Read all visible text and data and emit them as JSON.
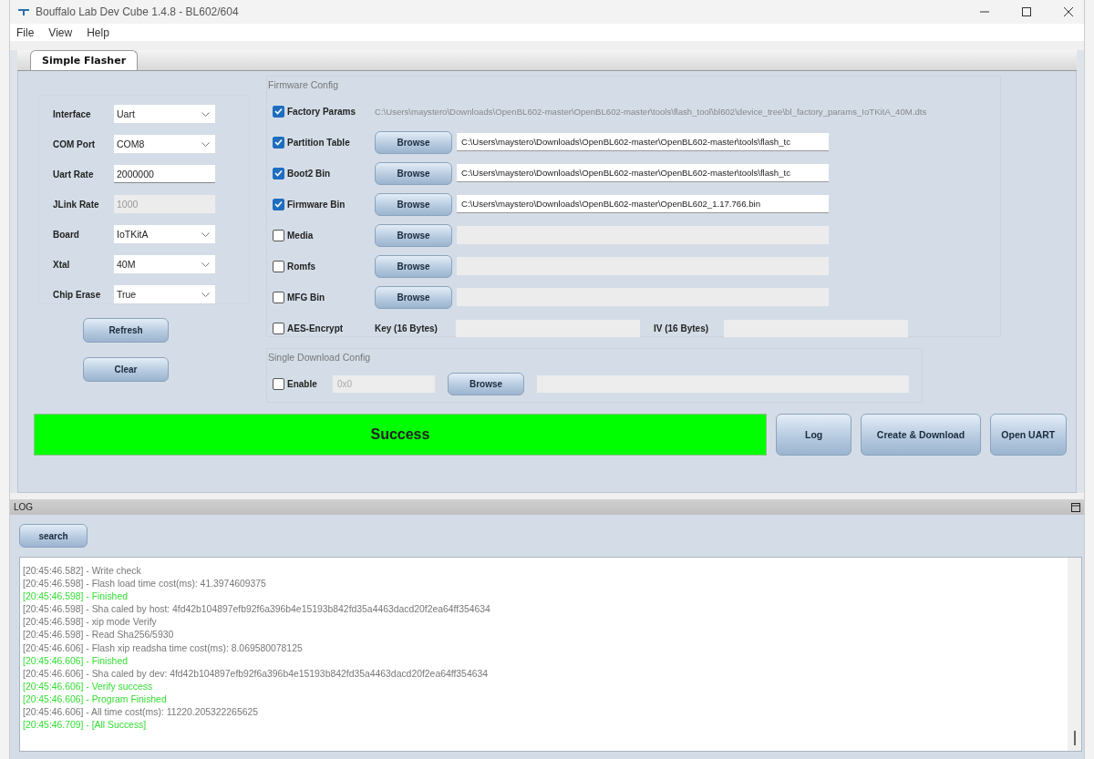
{
  "window": {
    "title": "Bouffalo Lab Dev Cube 1.4.8 - BL602/604"
  },
  "menu": [
    "File",
    "View",
    "Help"
  ],
  "tabs": [
    {
      "label": "Simple Flasher",
      "selected": true
    }
  ],
  "interface_config": {
    "fields": [
      {
        "label": "Interface",
        "kind": "select",
        "value": "Uart",
        "disabled": false
      },
      {
        "label": "COM Port",
        "kind": "select",
        "value": "COM8",
        "disabled": false
      },
      {
        "label": "Uart Rate",
        "kind": "input",
        "value": "2000000",
        "disabled": false
      },
      {
        "label": "JLink Rate",
        "kind": "input",
        "value": "1000",
        "disabled": true
      },
      {
        "label": "Board",
        "kind": "select",
        "value": "IoTKitA",
        "disabled": false
      },
      {
        "label": "Xtal",
        "kind": "select",
        "value": "40M",
        "disabled": false
      },
      {
        "label": "Chip Erase",
        "kind": "select",
        "value": "True",
        "disabled": false
      }
    ],
    "buttons": [
      "Refresh",
      "Clear"
    ]
  },
  "firmware_config": {
    "title": "Firmware Config",
    "rows": [
      {
        "kind": "text",
        "label": "Factory Params",
        "checked": true,
        "value": "C:\\Users\\maystero\\Downloads\\OpenBL602-master\\OpenBL602-master\\tools\\flash_tool\\bl602\\device_tree\\bl_factory_params_IoTKitA_40M.dts"
      },
      {
        "kind": "file",
        "label": "Partition Table",
        "checked": true,
        "button": "Browse",
        "value": "C:\\Users\\maystero\\Downloads\\OpenBL602-master\\OpenBL602-master\\tools\\flash_tc"
      },
      {
        "kind": "file",
        "label": "Boot2 Bin",
        "checked": true,
        "button": "Browse",
        "value": "C:\\Users\\maystero\\Downloads\\OpenBL602-master\\OpenBL602-master\\tools\\flash_tc"
      },
      {
        "kind": "file",
        "label": "Firmware Bin",
        "checked": true,
        "button": "Browse",
        "value": "C:\\Users\\maystero\\Downloads\\OpenBL602-master\\OpenBL602_1.17.766.bin"
      },
      {
        "kind": "file",
        "label": "Media",
        "checked": false,
        "button": "Browse"
      },
      {
        "kind": "file",
        "label": "Romfs",
        "checked": false,
        "button": "Browse"
      },
      {
        "kind": "file",
        "label": "MFG Bin",
        "checked": false,
        "button": "Browse"
      },
      {
        "kind": "aes",
        "label": "AES-Encrypt",
        "checked": false,
        "key_label": "Key (16 Bytes)",
        "iv_label": "IV (16 Bytes)"
      }
    ]
  },
  "single_download": {
    "title": "Single Download Config",
    "label": "Enable",
    "checked": false,
    "address": "0x0",
    "button": "Browse"
  },
  "status": {
    "kind": "success",
    "text": "Success"
  },
  "actions": [
    "Log",
    "Create & Download",
    "Open UART"
  ],
  "log": {
    "title": "LOG",
    "search_button": "search",
    "lines": [
      {
        "kind": "info",
        "text": "[20:45:46.582] - Write check"
      },
      {
        "kind": "info",
        "text": "[20:45:46.598] - Flash load time cost(ms): 41.3974609375"
      },
      {
        "kind": "success",
        "text": "[20:45:46.598] - Finished"
      },
      {
        "kind": "info",
        "text": "[20:45:46.598] - Sha caled by host: 4fd42b104897efb92f6a396b4e15193b842fd35a4463dacd20f2ea64ff354634"
      },
      {
        "kind": "info",
        "text": "[20:45:46.598] - xip mode Verify"
      },
      {
        "kind": "info",
        "text": "[20:45:46.598] - Read Sha256/5930"
      },
      {
        "kind": "info",
        "text": "[20:45:46.606] - Flash xip readsha time cost(ms): 8.069580078125"
      },
      {
        "kind": "success",
        "text": "[20:45:46.606] - Finished"
      },
      {
        "kind": "info",
        "text": "[20:45:46.606] - Sha caled by dev: 4fd42b104897efb92f6a396b4e15193b842fd35a4463dacd20f2ea64ff354634"
      },
      {
        "kind": "success",
        "text": "[20:45:46.606] - Verify success"
      },
      {
        "kind": "success",
        "text": "[20:45:46.606] - Program Finished"
      },
      {
        "kind": "info",
        "text": "[20:45:46.606] - All time cost(ms): 11220.205322265625"
      },
      {
        "kind": "success",
        "text": "[20:45:46.709] - [All Success]"
      }
    ]
  }
}
